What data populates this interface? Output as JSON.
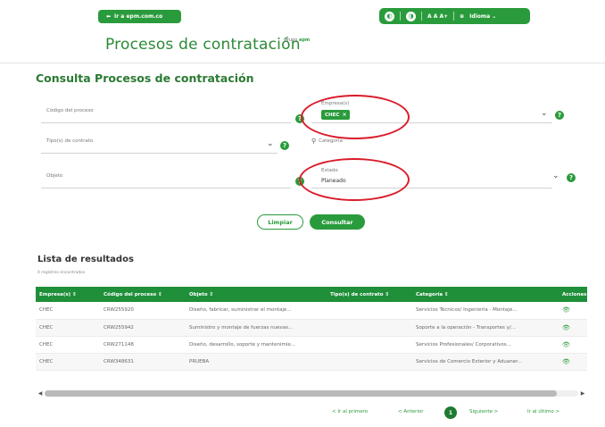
{
  "header": {
    "back_label": "Ir a epm.com.co",
    "accessibility": {
      "contrast_label": "",
      "font_size_label": "A A A+",
      "language_label": "Idioma"
    },
    "app_title": "Procesos de contratación",
    "brand_prefix": "Grupo",
    "brand_name": "epm"
  },
  "form": {
    "section_title": "Consulta Procesos de contratación",
    "codigo_label": "Código del proceso",
    "empresa_label": "Empresa(s)",
    "empresa_tag": "CHEC",
    "tipo_label": "Tipo(s) de contrato",
    "categoria_placeholder": "Categoría",
    "objeto_label": "Objeto",
    "estado_label": "Estado",
    "estado_value": "Planeado",
    "clear_label": "Limpiar",
    "search_label": "Consultar"
  },
  "results": {
    "title": "Lista de resultados",
    "count_text": "4 registros encontrados",
    "columns": [
      "Empresa(s) ⇕",
      "Código del proceso ⇕",
      "Objeto ⇕",
      "Tipo(s) de contrato ⇕",
      "Categoría ⇕",
      "Acciones"
    ],
    "rows": [
      [
        "CHEC",
        "CRW255920",
        "Diseño, fabricar, suministrar el montaje...",
        "",
        "Servicios Técnicos/ Ingeniería - Montaje...",
        "👁"
      ],
      [
        "CHEC",
        "CRW255942",
        "Suministro y montaje de fuerzas nuevas...",
        "",
        "Soporte a la operación - Transportes y/...",
        "👁"
      ],
      [
        "CHEC",
        "CRW271148",
        "Diseño, desarrollo, soporte y mantenimie...",
        "",
        "Servicios Profesionales/ Corporativos...",
        "👁"
      ],
      [
        "CHEC",
        "CRW348631",
        "PRUEBA",
        "",
        "Servicios de Comercio Exterior y Aduaner...",
        "👁"
      ]
    ]
  },
  "pagination": {
    "first_label": "< Ir al primero",
    "prev_label": "< Anterior",
    "current_page": "1",
    "next_label": "Siguiente >",
    "last_label": "Ir al último >"
  },
  "colors": {
    "primary_green": "#2a9b3c",
    "header_green": "#1f8f3a",
    "annotation_red": "#d91c2a"
  },
  "icons": {
    "eye": "eye-icon",
    "help": "help-icon",
    "chevron": "chevron-down-icon",
    "search": "search-icon"
  }
}
